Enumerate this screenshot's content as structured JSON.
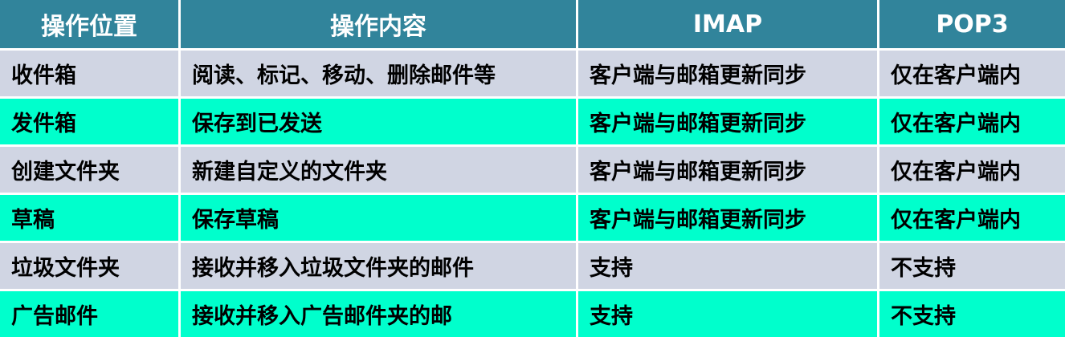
{
  "table": {
    "headers": [
      "操作位置",
      "操作内容",
      "IMAP",
      "POP3"
    ],
    "rows": [
      [
        "收件箱",
        "阅读、标记、移动、删除邮件等",
        "客户端与邮箱更新同步",
        "仅在客户端内"
      ],
      [
        "发件箱",
        "保存到已发送",
        "客户端与邮箱更新同步",
        "仅在客户端内"
      ],
      [
        "创建文件夹",
        "新建自定义的文件夹",
        "客户端与邮箱更新同步",
        "仅在客户端内"
      ],
      [
        "草稿",
        "保存草稿",
        "客户端与邮箱更新同步",
        "仅在客户端内"
      ],
      [
        "垃圾文件夹",
        "接收并移入垃圾文件夹的邮件",
        "支持",
        "不支持"
      ],
      [
        "广告邮件",
        "接收并移入广告邮件夹的邮",
        "支持",
        "不支持"
      ]
    ]
  },
  "colors": {
    "header_bg": "#31849b",
    "header_text": "#ffffff",
    "row_odd_bg": "#d0d5e3",
    "row_even_bg": "#00ffcc"
  }
}
